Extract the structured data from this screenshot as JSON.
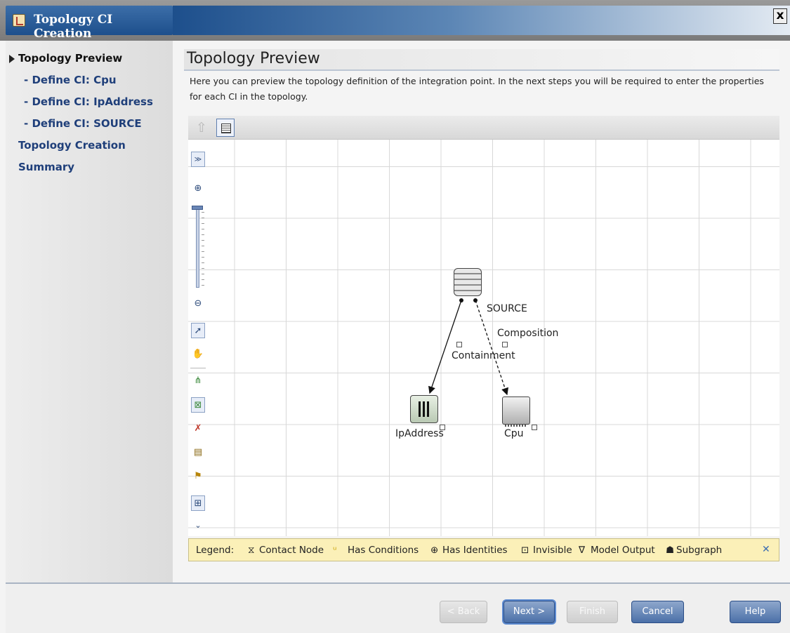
{
  "window": {
    "title": "Topology CI Creation",
    "close_label": "x"
  },
  "sidebar": {
    "items": [
      {
        "label": "Topology Preview",
        "active": true
      },
      {
        "label": "- Define CI: Cpu"
      },
      {
        "label": "- Define CI: IpAddress"
      },
      {
        "label": "- Define CI: SOURCE"
      },
      {
        "label": "Topology Creation"
      },
      {
        "label": "Summary"
      }
    ]
  },
  "main": {
    "title": "Topology Preview",
    "description": "Here you can preview the topology definition of the integration point. In the next steps you will be required to enter the properties for each CI in the topology."
  },
  "graph": {
    "nodes": [
      {
        "label": "SOURCE",
        "icon": "database-icon"
      },
      {
        "label": "IpAddress",
        "icon": "ip-address-icon"
      },
      {
        "label": "Cpu",
        "icon": "cpu-icon"
      }
    ],
    "edges": [
      {
        "label": "Containment",
        "from": "SOURCE",
        "to": "IpAddress"
      },
      {
        "label": "Composition",
        "from": "SOURCE",
        "to": "Cpu"
      }
    ]
  },
  "legend": {
    "title": "Legend:",
    "items": [
      {
        "symbol": "⧖",
        "label": "Contact Node"
      },
      {
        "symbol": "ᵘ",
        "label": "Has Conditions"
      },
      {
        "symbol": "⊕",
        "label": "Has Identities"
      },
      {
        "symbol": "⊡",
        "label": "Invisible"
      },
      {
        "symbol": "∇",
        "label": "Model Output"
      },
      {
        "symbol": "☗",
        "label": "Subgraph"
      }
    ],
    "close_symbol": "✕"
  },
  "buttons": {
    "back": "< Back",
    "next": "Next >",
    "finish": "Finish",
    "cancel": "Cancel",
    "help": "Help"
  }
}
